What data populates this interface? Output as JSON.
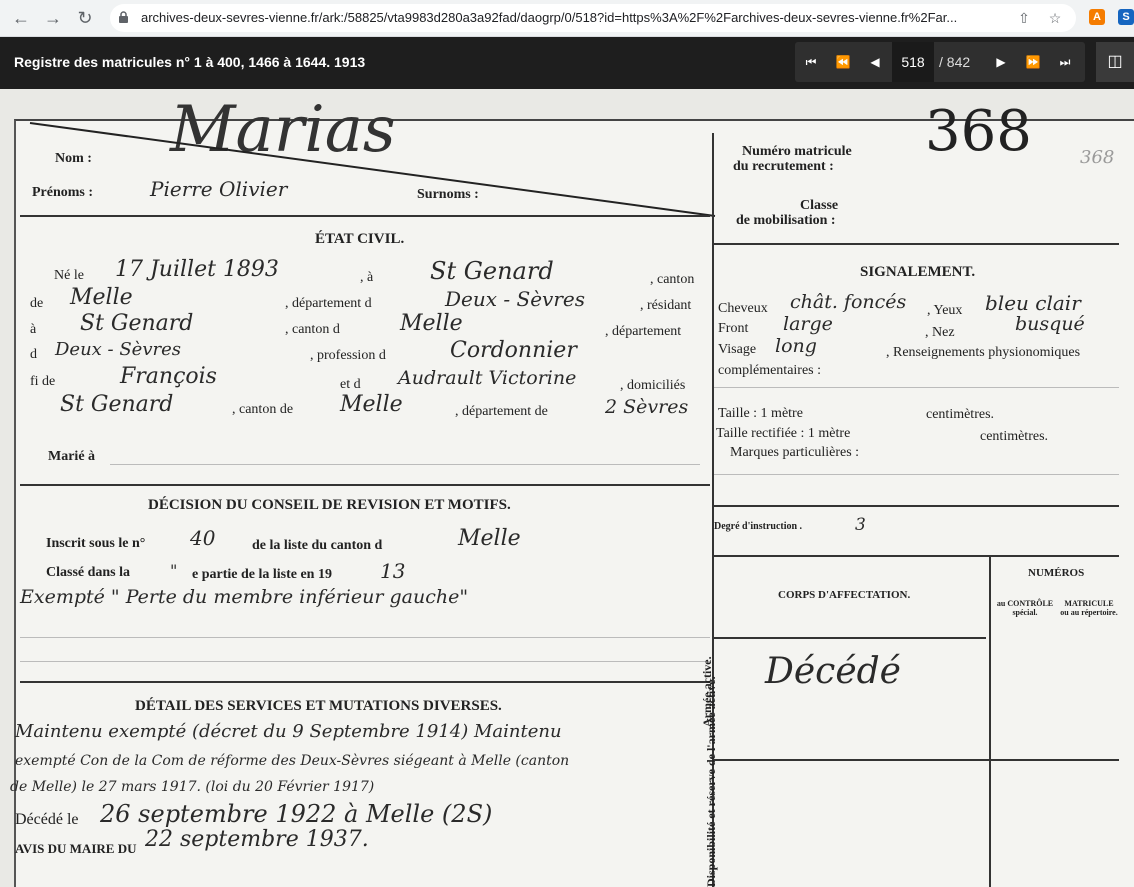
{
  "browser": {
    "url": "archives-deux-sevres-vienne.fr/ark:/58825/vta9983d280a3a92fad/daogrp/0/518?id=https%3A%2F%2Farchives-deux-sevres-vienne.fr%2Far..."
  },
  "viewer": {
    "title": "Registre des matricules n° 1 à 400, 1466 à 1644. 1913",
    "page_current": "518",
    "page_total": "/ 842"
  },
  "document": {
    "big_name": "Marias",
    "matricule_number": "368",
    "matricule_small": "368",
    "labels": {
      "nom": "Nom :",
      "prenoms": "Prénoms :",
      "surnoms": "Surnoms :",
      "etat_civil": "ÉTAT CIVIL.",
      "ne_le": "Né le",
      "a": ", à",
      "canton": ", canton",
      "de": "de",
      "departement_d": ", département d",
      "resident": ", résidant",
      "a2": "à",
      "canton_d": ", canton d",
      "departement": ", département",
      "d": "d",
      "profession_d": ", profession d",
      "fi_de": "fi de",
      "et_d": "et d",
      "domicilies": ", domiciliés",
      "canton_de": ", canton de",
      "departement_de": ", département de",
      "marie_a": "Marié à",
      "decision_title": "DÉCISION DU CONSEIL DE REVISION ET MOTIFS.",
      "inscrit": "Inscrit sous le n°",
      "de_la_liste": "de la liste du canton d",
      "classe_dans": "Classé dans la",
      "partie": "e partie de la liste en 19",
      "detail_title": "DÉTAIL DES SERVICES ET MUTATIONS DIVERSES.",
      "decede_le": "Décédé le",
      "avis_du_maire": "AVIS DU MAIRE DU",
      "numero_matricule": "Numéro matricule",
      "du_recrutement": "du recrutement :",
      "classe": "Classe",
      "de_mobilisation": "de mobilisation :",
      "signalement": "SIGNALEMENT.",
      "cheveux": "Cheveux",
      "yeux": ", Yeux",
      "front": "Front",
      "nez": ", Nez",
      "visage": "Visage",
      "renseignements": ", Renseignements physionomiques",
      "complementaires": "complémentaires :",
      "taille": "Taille : 1 mètre",
      "centimetres": "centimètres.",
      "taille_rectifiee": "Taille rectifiée : 1 mètre",
      "centimetres2": "centimètres.",
      "marques": "Marques particulières :",
      "degre": "Degré d'instruction .",
      "numeros": "NUMÉROS",
      "corps": "CORPS D'AFFECTATION.",
      "au_controle": "au CONTRÔLE spécial.",
      "matricule_repertoire": "MATRICULE ou au répertoire.",
      "armee_active": "Armée active.",
      "disponibilite": "Disponibilité et réserve de l'armée active."
    },
    "handwriting": {
      "prenoms": "Pierre Olivier",
      "birth_date": "17 Juillet 1893",
      "birth_place": "St Genard",
      "canton1": "Melle",
      "departement1": "Deux - Sèvres",
      "residence": "St Genard",
      "canton2": "Melle",
      "departement2": "Deux - Sèvres",
      "profession": "Cordonnier",
      "father": "François",
      "mother": "Audrault Victorine",
      "domicile": "St Genard",
      "canton3": "Melle",
      "departement3": "2 Sèvres",
      "inscrit_num": "40",
      "inscrit_canton": "Melle",
      "classe_partie": "\"",
      "classe_year": "13",
      "decision_note": "Exempté \" Perte du membre inférieur gauche\"",
      "cheveux": "chât. foncés",
      "yeux": "bleu clair",
      "front": "large",
      "nez": "busqué",
      "visage": "long",
      "degre": "3",
      "corps_note": "Décédé",
      "service_line1": "Maintenu exempté (décret du 9 Septembre 1914) Maintenu",
      "service_line2": "exempté Con de la Com de réforme des Deux-Sèvres siégeant à Melle (canton",
      "service_line3": "de Melle) le 27 mars 1917. (loi du 20 Février 1917)",
      "decede_date": "26 septembre 1922 à Melle (2S)",
      "avis_date": "22 septembre 1937."
    }
  }
}
